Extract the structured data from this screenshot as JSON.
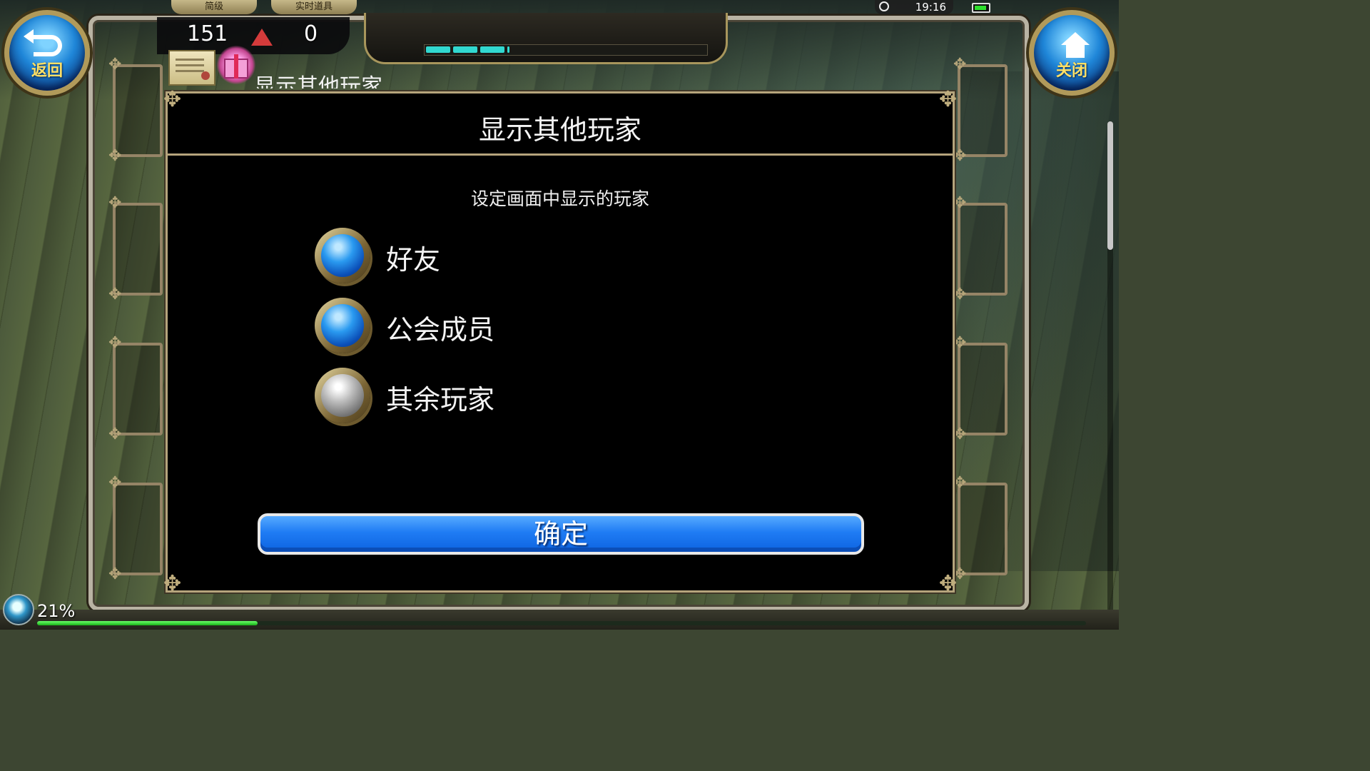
{
  "status": {
    "time": "19:16"
  },
  "hud": {
    "tab_left": "简级",
    "tab_right": "实时道具",
    "count_a": "151",
    "count_b": "0",
    "behind_title": "显示其他玩家",
    "gauge_fill": 0.3
  },
  "buttons": {
    "back_label": "返回",
    "close_label": "关闭"
  },
  "dialog": {
    "title": "显示其他玩家",
    "subtitle": "设定画面中显示的玩家",
    "options": [
      {
        "label": "好友",
        "checked": true
      },
      {
        "label": "公会成员",
        "checked": true
      },
      {
        "label": "其余玩家",
        "checked": false
      }
    ],
    "confirm_label": "确定"
  },
  "exp": {
    "percent_text": "21%",
    "fill": 0.21
  },
  "colors": {
    "accent_blue": "#1f7cf4",
    "frame_gold": "#b5a47c",
    "gauge_cyan": "#31d8d0"
  }
}
